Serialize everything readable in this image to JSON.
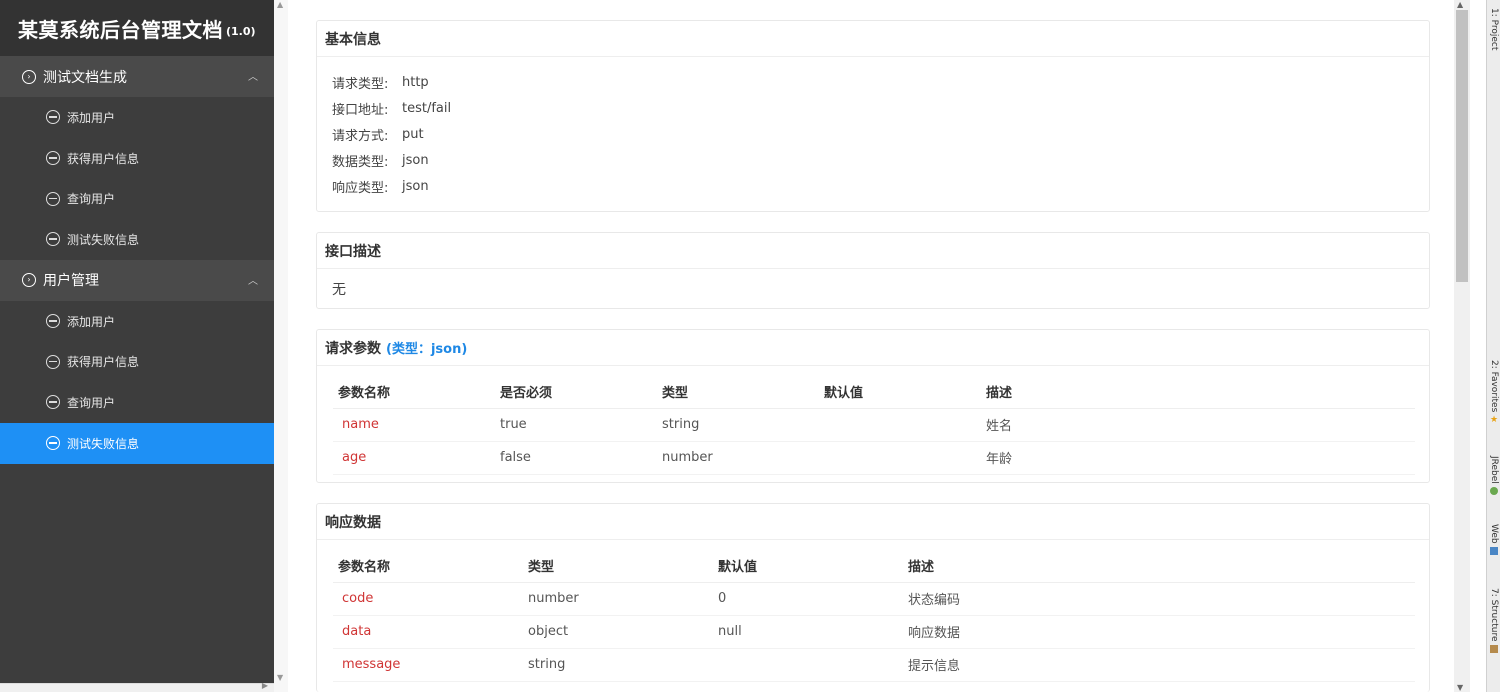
{
  "sidebar": {
    "title": "某莫系统后台管理文档",
    "version": "(1.0)",
    "groups": [
      {
        "label": "测试文档生成",
        "items": [
          {
            "label": "添加用户"
          },
          {
            "label": "获得用户信息"
          },
          {
            "label": "查询用户"
          },
          {
            "label": "测试失败信息"
          }
        ]
      },
      {
        "label": "用户管理",
        "items": [
          {
            "label": "添加用户"
          },
          {
            "label": "获得用户信息"
          },
          {
            "label": "查询用户"
          },
          {
            "label": "测试失败信息"
          }
        ]
      }
    ]
  },
  "basic": {
    "title": "基本信息",
    "rows": [
      {
        "k": "请求类型:",
        "v": "http"
      },
      {
        "k": "接口地址:",
        "v": "test/fail"
      },
      {
        "k": "请求方式:",
        "v": "put"
      },
      {
        "k": "数据类型:",
        "v": "json"
      },
      {
        "k": "响应类型:",
        "v": "json"
      }
    ]
  },
  "description": {
    "title": "接口描述",
    "text": "无"
  },
  "request": {
    "title": "请求参数",
    "sub": "(类型：json)",
    "headers": [
      "参数名称",
      "是否必须",
      "类型",
      "默认值",
      "描述"
    ],
    "rows": [
      [
        "name",
        "true",
        "string",
        "",
        "姓名"
      ],
      [
        "age",
        "false",
        "number",
        "",
        "年龄"
      ]
    ]
  },
  "response": {
    "title": "响应数据",
    "headers": [
      "参数名称",
      "类型",
      "默认值",
      "描述"
    ],
    "rows": [
      [
        "code",
        "number",
        "0",
        "状态编码"
      ],
      [
        "data",
        "object",
        "null",
        "响应数据"
      ],
      [
        "message",
        "string",
        "",
        "提示信息"
      ]
    ]
  },
  "ide_tabs": [
    "1: Project",
    "2: Favorites",
    "JRebel",
    "Web",
    "7: Structure"
  ],
  "colors": {
    "active": "#1e90f5",
    "param_name": "#d03535",
    "accent": "#1e88e5"
  }
}
